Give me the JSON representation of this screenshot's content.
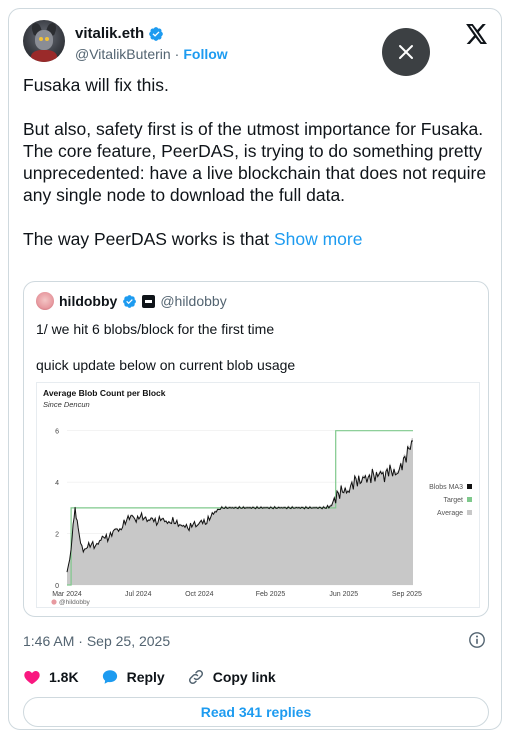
{
  "author": {
    "display_name": "vitalik.eth",
    "handle": "@VitalikButerin",
    "separator": "·",
    "follow_label": "Follow"
  },
  "tweet": {
    "p1": "Fusaka will fix this.",
    "p2": "But also, safety first is of the utmost importance for Fusaka. The core feature, PeerDAS, is trying to do something pretty unprecedented: have a live blockchain that does not require any single node to download the full data.",
    "p3": "The way PeerDAS works is that",
    "show_more": "Show more"
  },
  "quote": {
    "display_name": "hildobby",
    "handle": "@hildobby",
    "line1": "1/ we hit 6 blobs/block for the first time",
    "line2": "quick update below on current blob usage"
  },
  "chart_data": {
    "type": "area",
    "title": "Average Blob Count per Block",
    "subtitle": "Since Dencun",
    "x_ticks": [
      "Mar 2024",
      "Jul 2024",
      "Oct 2024",
      "Feb 2025",
      "Jun 2025",
      "Sep 2025"
    ],
    "y_ticks": [
      "0",
      "2",
      "4",
      "6"
    ],
    "ylim": [
      0,
      6.3
    ],
    "legend": [
      "Blobs MA3",
      "Target",
      "Average"
    ],
    "legend_position": "right",
    "watermark": "@hildobby",
    "colors": {
      "average": "#c8c8c8",
      "ma3": "#111111",
      "target": "#7fc98c"
    },
    "series": [
      {
        "name": "Target",
        "points": [
          [
            0,
            0
          ],
          [
            1,
            0
          ],
          [
            1,
            3
          ],
          [
            66,
            3
          ],
          [
            66,
            6
          ],
          [
            85,
            6
          ]
        ]
      },
      {
        "name": "Blobs MA3",
        "points": [
          [
            0,
            0.5
          ],
          [
            1,
            1.3
          ],
          [
            1.5,
            2.4
          ],
          [
            2,
            2.9
          ],
          [
            2.5,
            2.5
          ],
          [
            3,
            1.9
          ],
          [
            4,
            1.3
          ],
          [
            5,
            1.5
          ],
          [
            6,
            1.6
          ],
          [
            7,
            1.5
          ],
          [
            8,
            1.7
          ],
          [
            9,
            1.9
          ],
          [
            10,
            1.8
          ],
          [
            11,
            2.0
          ],
          [
            12,
            2.2
          ],
          [
            13,
            2.1
          ],
          [
            14,
            2.4
          ],
          [
            15,
            2.6
          ],
          [
            16,
            2.7
          ],
          [
            17,
            2.5
          ],
          [
            18,
            2.7
          ],
          [
            19,
            2.6
          ],
          [
            20,
            2.5
          ],
          [
            21,
            2.6
          ],
          [
            22,
            2.4
          ],
          [
            23,
            2.6
          ],
          [
            24,
            2.5
          ],
          [
            25,
            2.4
          ],
          [
            26,
            2.5
          ],
          [
            27,
            2.4
          ],
          [
            28,
            2.3
          ],
          [
            29,
            2.3
          ],
          [
            30,
            2.2
          ],
          [
            31,
            2.4
          ],
          [
            32,
            2.3
          ],
          [
            33,
            2.5
          ],
          [
            34,
            2.4
          ],
          [
            35,
            2.6
          ],
          [
            36,
            2.8
          ],
          [
            37,
            2.9
          ],
          [
            38,
            3.0
          ],
          [
            40,
            3.0
          ],
          [
            42,
            3.0
          ],
          [
            44,
            3.0
          ],
          [
            46,
            3.0
          ],
          [
            48,
            3.0
          ],
          [
            50,
            3.0
          ],
          [
            52,
            3.0
          ],
          [
            54,
            3.0
          ],
          [
            56,
            3.0
          ],
          [
            58,
            3.0
          ],
          [
            60,
            3.0
          ],
          [
            62,
            3.0
          ],
          [
            64,
            3.0
          ],
          [
            65,
            3.1
          ],
          [
            66,
            3.4
          ],
          [
            67,
            3.6
          ],
          [
            68,
            3.7
          ],
          [
            69,
            3.6
          ],
          [
            70,
            3.9
          ],
          [
            71,
            4.1
          ],
          [
            72,
            4.0
          ],
          [
            73,
            4.2
          ],
          [
            74,
            4.1
          ],
          [
            75,
            4.3
          ],
          [
            76,
            4.2
          ],
          [
            77,
            4.4
          ],
          [
            78,
            4.2
          ],
          [
            79,
            4.5
          ],
          [
            80,
            4.4
          ],
          [
            81,
            4.3
          ],
          [
            82,
            4.6
          ],
          [
            83,
            4.9
          ],
          [
            84,
            5.3
          ],
          [
            85,
            5.6
          ]
        ]
      }
    ]
  },
  "meta": {
    "time": "1:46 AM",
    "dot": "·",
    "date": "Sep 25, 2025"
  },
  "actions": {
    "likes": "1.8K",
    "reply": "Reply",
    "copy": "Copy link",
    "read_replies": "Read 341 replies"
  }
}
